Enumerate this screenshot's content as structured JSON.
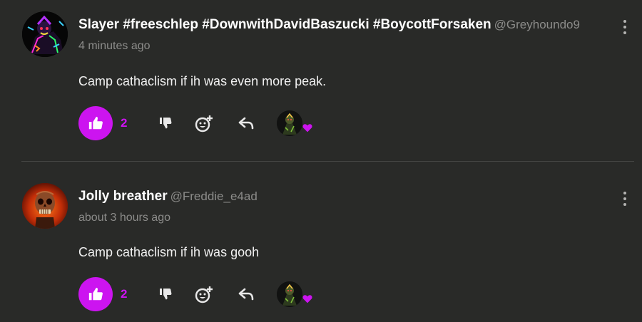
{
  "comments": [
    {
      "display_name": "Slayer #freeschlep #DownwithDavidBaszucki #BoycottForsaken",
      "handle": "@Greyhoundo9",
      "timestamp": "4 minutes ago",
      "body": "Camp cathaclism if ih was even more peak.",
      "like_count": "2",
      "avatar_icon": "glitch-character-avatar",
      "reactor_icon": "character-avatar",
      "reaction_icon": "heart-icon"
    },
    {
      "display_name": "Jolly breather",
      "handle": "@Freddie_e4ad",
      "timestamp": "about 3 hours ago",
      "body": "Camp cathaclism if ih was gooh",
      "like_count": "2",
      "avatar_icon": "skull-avatar",
      "reactor_icon": "character-avatar",
      "reaction_icon": "heart-icon"
    }
  ],
  "colors": {
    "background": "#292a28",
    "accent": "#cc14f0",
    "muted_text": "#8c8c8a",
    "divider": "#444544"
  }
}
